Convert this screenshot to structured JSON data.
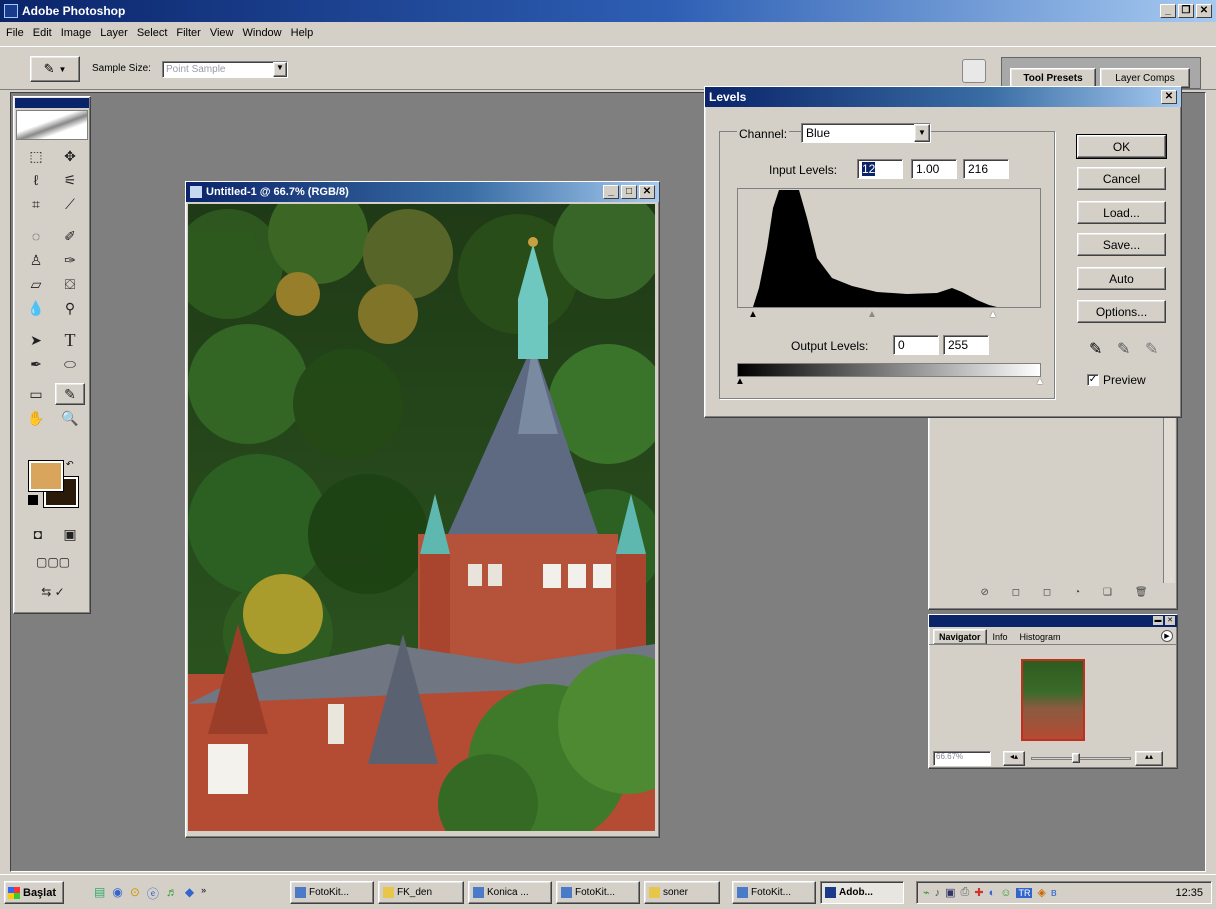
{
  "app": {
    "title": "Adobe Photoshop"
  },
  "menu": [
    "File",
    "Edit",
    "Image",
    "Layer",
    "Select",
    "Filter",
    "View",
    "Window",
    "Help"
  ],
  "options_bar": {
    "sample_size_label": "Sample Size:",
    "sample_size_value": "Point Sample"
  },
  "palette_well": {
    "tabs": [
      "Tool Presets",
      "Layer Comps"
    ]
  },
  "document": {
    "title": "Untitled-1 @ 66.7% (RGB/8)"
  },
  "levels": {
    "title": "Levels",
    "channel_label": "Channel:",
    "channel_value": "Blue",
    "input_label": "Input Levels:",
    "input_values": [
      "12",
      "1.00",
      "216"
    ],
    "output_label": "Output Levels:",
    "output_values": [
      "0",
      "255"
    ],
    "buttons": {
      "ok": "OK",
      "cancel": "Cancel",
      "load": "Load...",
      "save": "Save...",
      "auto": "Auto",
      "options": "Options..."
    },
    "preview_label": "Preview",
    "preview_checked": true
  },
  "navigator": {
    "tabs": [
      "Navigator",
      "Info",
      "Histogram"
    ],
    "zoom": "66.67%"
  },
  "taskbar": {
    "start": "Başlat",
    "tasks": [
      "FotoKit...",
      "FK_den",
      "Konica ...",
      "FotoKit...",
      "soner",
      "FotoKit...",
      "Adob..."
    ],
    "clock": "12:35",
    "lang": "TR"
  },
  "colors": {
    "foreground": "#d9a45c",
    "background": "#2a1a0a",
    "title_active": "#0a246a",
    "desktop_gray": "#7f7f7f"
  }
}
